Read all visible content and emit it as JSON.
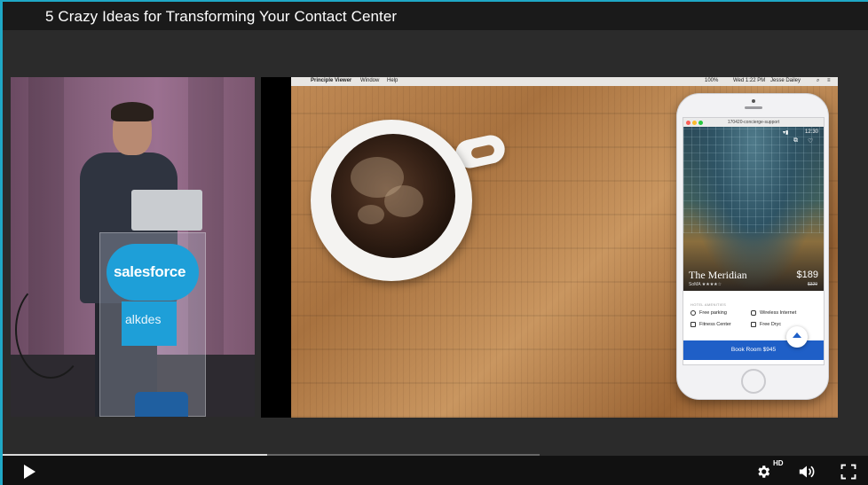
{
  "player": {
    "title": "5 Crazy Ideas for Transforming Your Contact Center",
    "progress_fraction": 0.305,
    "controls": {
      "play_icon": "play-icon",
      "settings_icon": "gear-icon",
      "quality_badge": "HD",
      "volume_icon": "speaker-icon",
      "fullscreen_icon": "fullscreen-icon"
    }
  },
  "speaker_video": {
    "podium_brand": "salesforce",
    "banner_text": "alkdes"
  },
  "slide": {
    "menubar": {
      "app_name": "Principle Viewer",
      "menu_window": "Window",
      "menu_help": "Help",
      "battery": "100%",
      "clock": "Wed 1:22 PM",
      "user": "Jesse Dailey"
    },
    "simulator": {
      "window_title": "170420-concierge-support",
      "status_time": "12:30",
      "hotel_name": "The Meridian",
      "location": "SoMA",
      "rating_stars": "★★★★☆",
      "price": "$189",
      "old_price": "$329",
      "amenities_title": "HOTEL AMENITIES",
      "amenities": [
        "Free parking",
        "Wireless Internet",
        "Fitness Center",
        "Free Dryc"
      ],
      "book_label": "Book Room $945"
    }
  }
}
